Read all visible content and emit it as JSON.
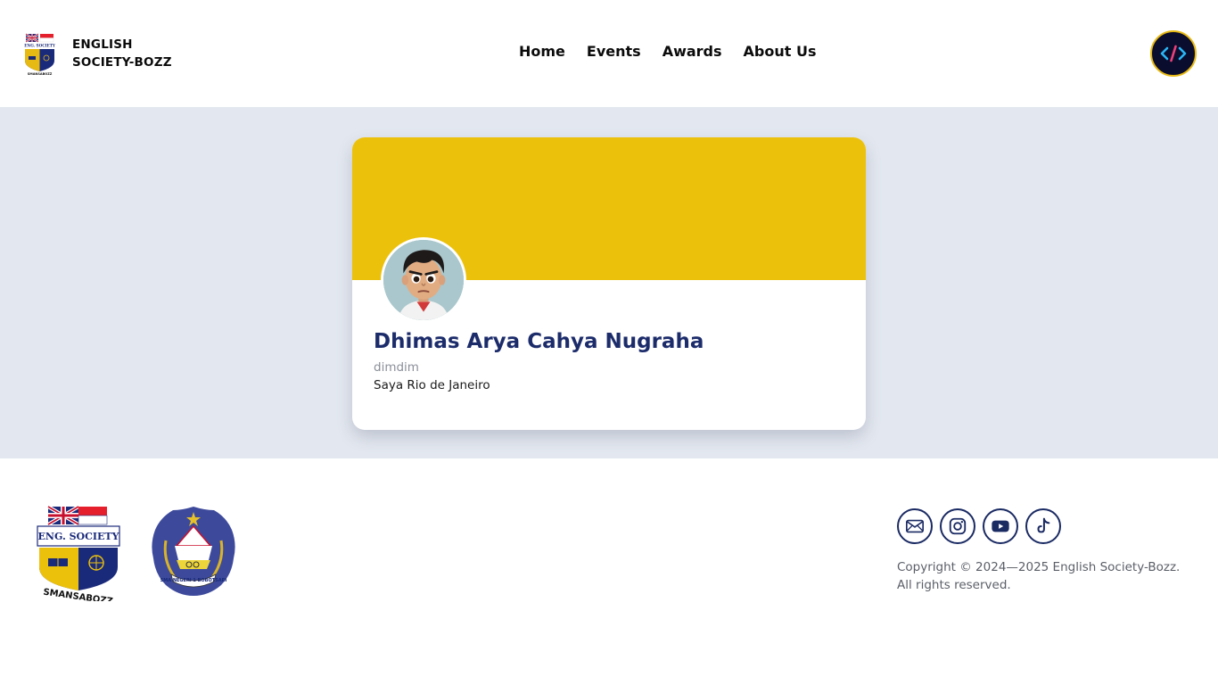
{
  "header": {
    "brand_line1": "ENGLISH",
    "brand_line2": "SOCIETY-BOZZ",
    "nav": [
      "Home",
      "Events",
      "Awards",
      "About Us"
    ],
    "dev_label": "</>"
  },
  "profile": {
    "name": "Dhimas Arya Cahya Nugraha",
    "username": "dimdim",
    "bio": "Saya Rio de Janeiro",
    "cover_color": "#ecc10c"
  },
  "footer": {
    "logo1_top": "ENG. SOCIETY",
    "logo1_bottom": "SMANSABOZZ",
    "logo2_text": "SMA NEGERI 1 BOBOTSARI",
    "socials": [
      "mail-icon",
      "instagram-icon",
      "youtube-icon",
      "tiktok-icon"
    ],
    "copyright_line1": "Copyright © 2024—2025 English Society-Bozz.",
    "copyright_line2": "All rights reserved."
  },
  "colors": {
    "accent_yellow": "#ecc10c",
    "navy": "#1c2c6b",
    "background": "#e3e8f0"
  }
}
